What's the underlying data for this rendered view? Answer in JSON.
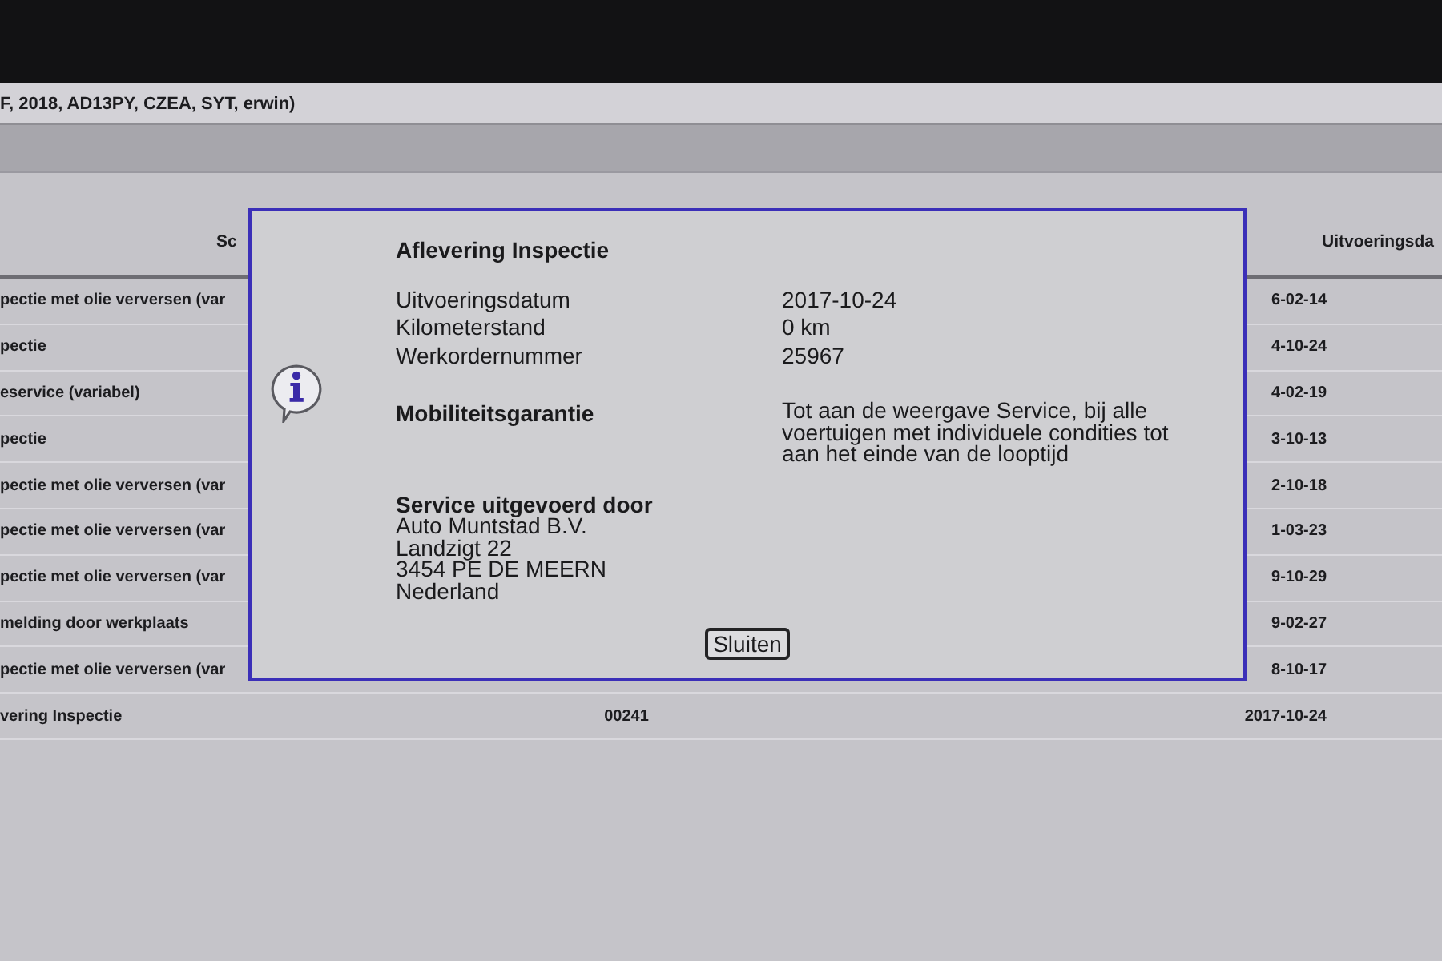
{
  "title_bar": {
    "text": "F, 2018, AD13PY, CZEA, SYT, erwin)"
  },
  "table": {
    "columns": [
      {
        "label": "Sc"
      },
      {
        "label": "Uitvoeringsda"
      }
    ],
    "rows": [
      {
        "column_1": "pectie met olie verversen (var",
        "column_3": "6-02-14"
      },
      {
        "column_1": "pectie",
        "column_3": "4-10-24"
      },
      {
        "column_1": "eservice (variabel)",
        "column_3": "4-02-19"
      },
      {
        "column_1": "pectie",
        "column_3": "3-10-13"
      },
      {
        "column_1": "pectie met olie verversen (var",
        "column_3": "2-10-18"
      },
      {
        "column_1": "pectie met olie verversen (var",
        "column_3": "1-03-23"
      },
      {
        "column_1": "pectie met olie verversen (var",
        "column_3": "9-10-29"
      },
      {
        "column_1": "melding door werkplaats",
        "column_3": "9-02-27"
      },
      {
        "column_1": "pectie met olie verversen (var",
        "column_3": "8-10-17"
      },
      {
        "column_1": "vering Inspectie",
        "column_2": "00241",
        "column_3": "2017-10-24"
      }
    ]
  },
  "dialog": {
    "title": "Aflevering Inspectie",
    "fields": [
      {
        "label": "Uitvoeringsdatum",
        "value": "2017-10-24"
      },
      {
        "label": "Kilometerstand",
        "value": "0 km"
      },
      {
        "label": "Werkordernummer",
        "value": "25967"
      }
    ],
    "notice": {
      "label": "Mobiliteitsgarantie",
      "text": "Tot aan de weergave Service, bij alle voertuigen met individuele condities tot aan het einde van de looptijd"
    },
    "service_provider": {
      "heading": "Service uitgevoerd door",
      "lines": [
        "Auto Muntstad B.V.",
        "Landzigt 22",
        "3454 PE DE MEERN",
        "Nederland"
      ]
    },
    "buttons": [
      "Sluiten"
    ]
  }
}
